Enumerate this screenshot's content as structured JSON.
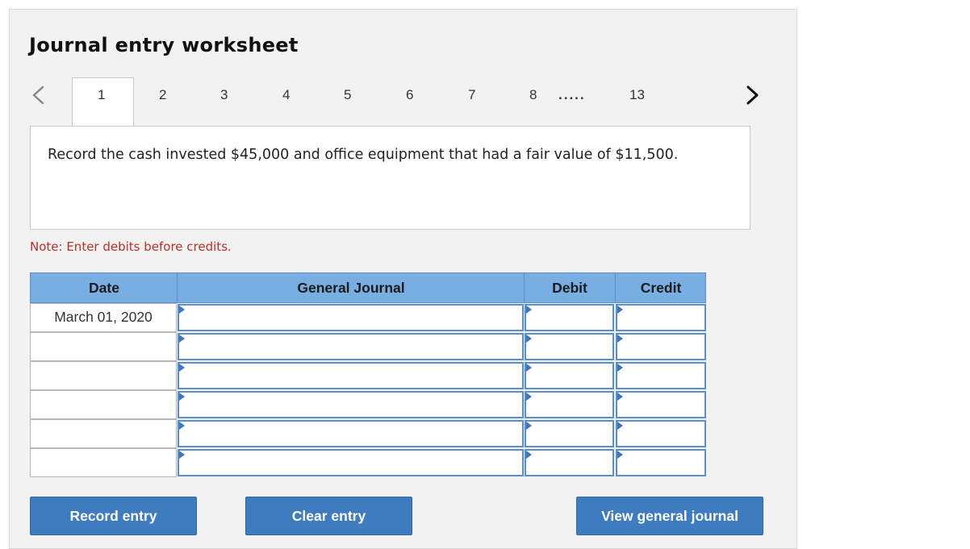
{
  "title": "Journal entry worksheet",
  "tabs": [
    "1",
    "2",
    "3",
    "4",
    "5",
    "6",
    "7",
    "8",
    "13"
  ],
  "tabs_ellipsis": ".....",
  "active_tab": "1",
  "instruction": "Record the cash invested $45,000 and office equipment that had a fair value of $11,500.",
  "note": "Note: Enter debits before credits.",
  "table": {
    "headers": {
      "date": "Date",
      "general_journal": "General Journal",
      "debit": "Debit",
      "credit": "Credit"
    },
    "rows": [
      {
        "date": "March 01, 2020",
        "account": "",
        "debit": "",
        "credit": ""
      },
      {
        "date": "",
        "account": "",
        "debit": "",
        "credit": ""
      },
      {
        "date": "",
        "account": "",
        "debit": "",
        "credit": ""
      },
      {
        "date": "",
        "account": "",
        "debit": "",
        "credit": ""
      },
      {
        "date": "",
        "account": "",
        "debit": "",
        "credit": ""
      },
      {
        "date": "",
        "account": "",
        "debit": "",
        "credit": ""
      }
    ]
  },
  "buttons": {
    "record": "Record entry",
    "clear": "Clear entry",
    "view": "View general journal"
  },
  "colors": {
    "header_bg": "#79aee3",
    "button_bg": "#3f7bbf",
    "note": "#b5302a",
    "input_border": "#5b8fc7"
  },
  "icons": {
    "prev": "chevron-left-icon",
    "next": "chevron-right-icon",
    "dropdown_marker": "triangle-marker-icon"
  }
}
